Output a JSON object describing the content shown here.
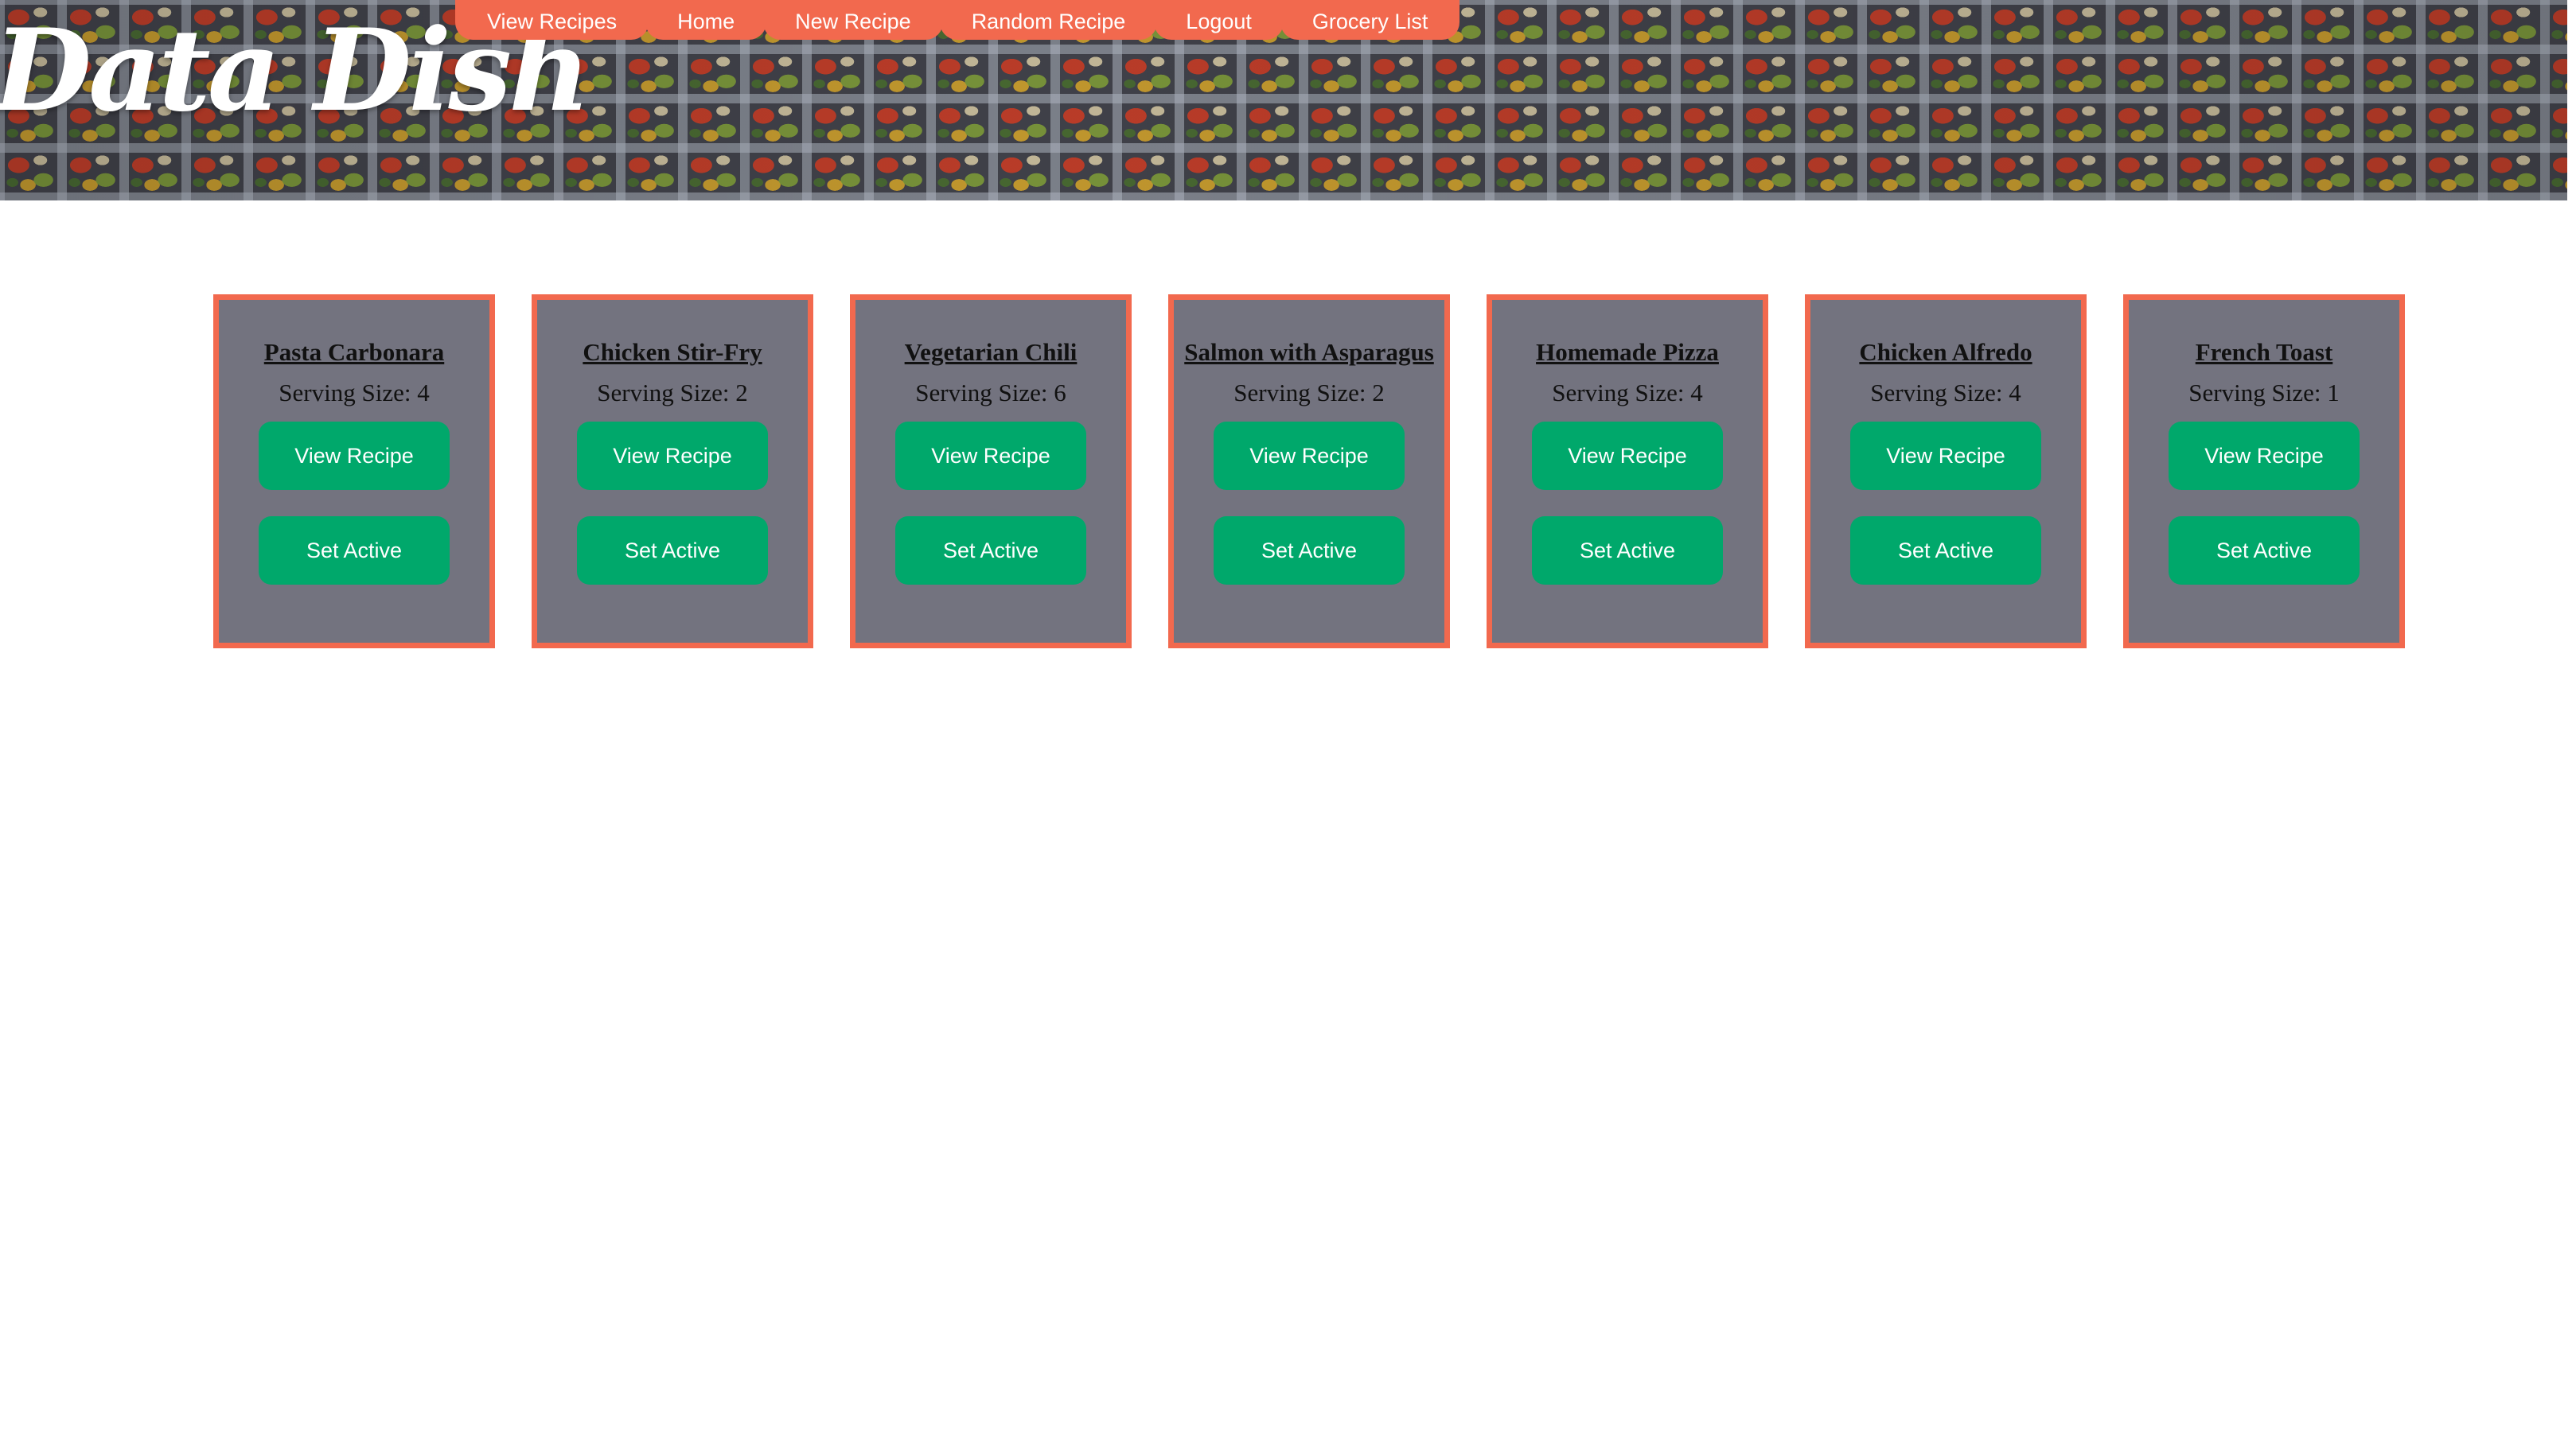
{
  "brand": {
    "title": "Data Dish"
  },
  "nav": {
    "items": [
      {
        "id": "view-recipes",
        "label": "View Recipes"
      },
      {
        "id": "home",
        "label": "Home"
      },
      {
        "id": "new-recipe",
        "label": "New Recipe"
      },
      {
        "id": "random-recipe",
        "label": "Random Recipe"
      },
      {
        "id": "logout",
        "label": "Logout"
      },
      {
        "id": "grocery-list",
        "label": "Grocery List"
      }
    ]
  },
  "recipes": [
    {
      "title": "Pasta Carbonara",
      "serving": "Serving Size: 4",
      "view_label": "View Recipe",
      "active_label": "Set Active"
    },
    {
      "title": "Chicken Stir-Fry",
      "serving": "Serving Size: 2",
      "view_label": "View Recipe",
      "active_label": "Set Active"
    },
    {
      "title": "Vegetarian Chili",
      "serving": "Serving Size: 6",
      "view_label": "View Recipe",
      "active_label": "Set Active"
    },
    {
      "title": "Salmon with Asparagus",
      "serving": "Serving Size: 2",
      "view_label": "View Recipe",
      "active_label": "Set Active"
    },
    {
      "title": "Homemade Pizza",
      "serving": "Serving Size: 4",
      "view_label": "View Recipe",
      "active_label": "Set Active"
    },
    {
      "title": "Chicken Alfredo",
      "serving": "Serving Size: 4",
      "view_label": "View Recipe",
      "active_label": "Set Active"
    },
    {
      "title": "French Toast",
      "serving": "Serving Size: 1",
      "view_label": "View Recipe",
      "active_label": "Set Active"
    }
  ],
  "colors": {
    "nav_background": "#f2694e",
    "card_border": "#f2694e",
    "card_background": "#73737f",
    "button_background": "#00a86b",
    "button_text": "#ffffff"
  }
}
